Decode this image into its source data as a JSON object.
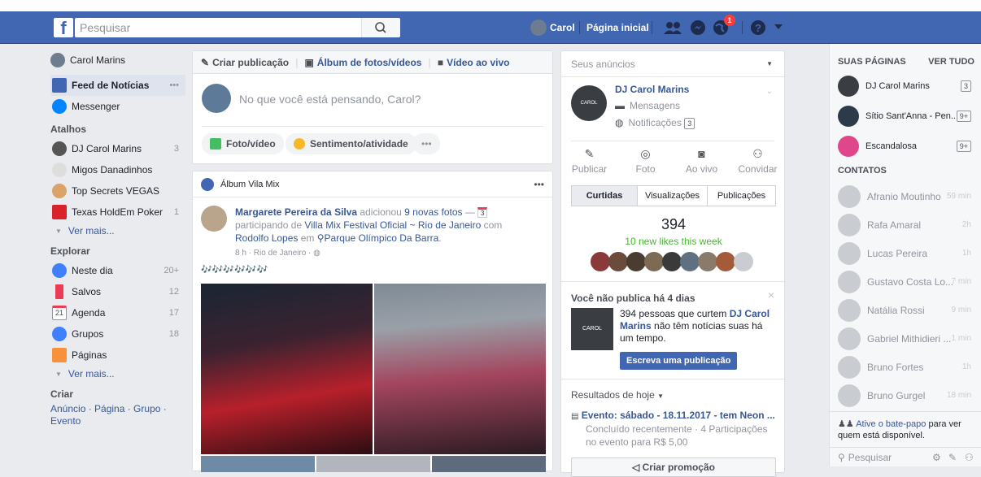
{
  "topbar": {
    "logo": "f",
    "search_placeholder": "Pesquisar",
    "user_name": "Carol",
    "home_label": "Página inicial",
    "notif_count": "1"
  },
  "left": {
    "user": "Carol Marins",
    "feed": "Feed de Notícias",
    "feed_more": "•••",
    "messenger": "Messenger",
    "atalhos_title": "Atalhos",
    "shortcuts": [
      {
        "label": "DJ Carol Marins",
        "count": "3"
      },
      {
        "label": "Migos Danadinhos",
        "count": ""
      },
      {
        "label": "Top Secrets VEGAS",
        "count": ""
      },
      {
        "label": "Texas HoldEm Poker",
        "count": "1"
      }
    ],
    "ver_mais_1": "Ver mais...",
    "explorar_title": "Explorar",
    "explore": [
      {
        "label": "Neste dia",
        "count": "20+"
      },
      {
        "label": "Salvos",
        "count": "12"
      },
      {
        "label": "Agenda",
        "count": "17"
      },
      {
        "label": "Grupos",
        "count": "18"
      },
      {
        "label": "Páginas",
        "count": ""
      }
    ],
    "calendar_day": "21",
    "ver_mais_2": "Ver mais...",
    "criar_title": "Criar",
    "criar_links": "Anúncio · Página · Grupo · Evento"
  },
  "composer": {
    "tab_create": "Criar publicação",
    "tab_album": "Álbum de fotos/vídeos",
    "tab_live": "Vídeo ao vivo",
    "placeholder": "No que você está pensando, Carol?",
    "btn_photo": "Foto/vídeo",
    "btn_feeling": "Sentimento/atividade",
    "btn_more": "•••"
  },
  "post": {
    "header": "Álbum Vila Mix",
    "more": "•••",
    "author": "Margarete Pereira da Silva",
    "action": " adicionou ",
    "photos_link": "9 novas fotos",
    "dash": " — ",
    "cal_num": "3",
    "participating": "participando de ",
    "event_link": "Villa Mix Festival Oficial ~ Rio de Janeiro",
    "with": " com",
    "friend": "Rodolfo Lopes",
    "at": " em ",
    "place": "Parque Olímpico Da Barra",
    "period": ".",
    "meta": "8 h · Rio de Janeiro · ",
    "notes": "🎶🎶🎶🎶🎶🎶"
  },
  "ads": {
    "title": "Seus anúncios",
    "page_name": "DJ Carol Marins",
    "page_logo_text": "CAROL MARINS",
    "messages": "Mensagens",
    "notifications": "Notificações",
    "notif_badge": "3",
    "actions": [
      {
        "label": "Publicar",
        "icon": "edit-icon"
      },
      {
        "label": "Foto",
        "icon": "camera-icon"
      },
      {
        "label": "Ao vivo",
        "icon": "live-video-icon"
      },
      {
        "label": "Convidar",
        "icon": "add-person-icon"
      }
    ],
    "tabs": [
      "Curtidas",
      "Visualizações",
      "Publicações"
    ],
    "likes": "394",
    "new_likes": "10 new likes this week",
    "no_post_title": "Você não publica há 4 dias",
    "close": "×",
    "no_post_pre": "394 pessoas que curtem ",
    "no_post_link": "DJ Carol Marins",
    "no_post_post": " não têm notícias suas há um tempo.",
    "write_btn": "Escreva uma publicação",
    "results_title": "Resultados de hoje",
    "event_title": "Evento: sábado - 18.11.2017 - tem Neon ...",
    "event_desc": "Concluído recentemente · 4 Participações no evento para R$ 5,00",
    "promo_btn": "Criar promoção"
  },
  "chat": {
    "pages_title": "SUAS PÁGINAS",
    "see_all": "VER TUDO",
    "pages": [
      {
        "name": "DJ Carol Marins",
        "badge": "3"
      },
      {
        "name": "Sítio Sant'Anna - Pen...",
        "badge": "9+"
      },
      {
        "name": "Escandalosa",
        "badge": "9+"
      }
    ],
    "contacts_title": "CONTATOS",
    "contacts": [
      {
        "name": "Afranio Moutinho",
        "time": "59 min"
      },
      {
        "name": "Rafa Amaral",
        "time": "2h"
      },
      {
        "name": "Lucas Pereira",
        "time": "1h"
      },
      {
        "name": "Gustavo Costa Lo...",
        "time": "7 min"
      },
      {
        "name": "Natália Rossi",
        "time": "9 min"
      },
      {
        "name": "Gabriel Mithidieri ...",
        "time": "1 min"
      },
      {
        "name": "Bruno Fortes",
        "time": "1h"
      },
      {
        "name": "Bruno Gurgel",
        "time": "18 min"
      }
    ],
    "activate_link": "Ative o bate-papo",
    "activate_rest": " para ver quem está disponível.",
    "search_placeholder": "Pesquisar"
  }
}
